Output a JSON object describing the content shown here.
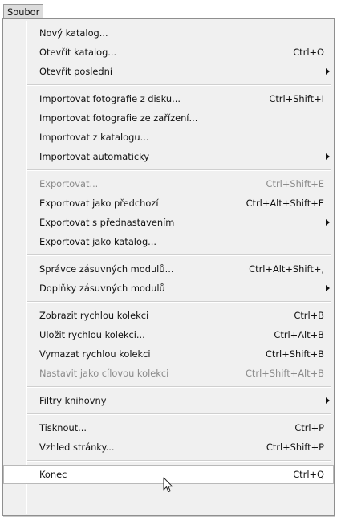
{
  "menu": {
    "title": "Soubor"
  },
  "groups": [
    [
      {
        "label": "Nový katalog...",
        "shortcut": "",
        "submenu": false,
        "disabled": false
      },
      {
        "label": "Otevřít katalog...",
        "shortcut": "Ctrl+O",
        "submenu": false,
        "disabled": false
      },
      {
        "label": "Otevřít poslední",
        "shortcut": "",
        "submenu": true,
        "disabled": false
      }
    ],
    [
      {
        "label": "Importovat fotografie z disku...",
        "shortcut": "Ctrl+Shift+I",
        "submenu": false,
        "disabled": false
      },
      {
        "label": "Importovat fotografie ze zařízení...",
        "shortcut": "",
        "submenu": false,
        "disabled": false
      },
      {
        "label": "Importovat z katalogu...",
        "shortcut": "",
        "submenu": false,
        "disabled": false
      },
      {
        "label": "Importovat automaticky",
        "shortcut": "",
        "submenu": true,
        "disabled": false
      }
    ],
    [
      {
        "label": "Exportovat...",
        "shortcut": "Ctrl+Shift+E",
        "submenu": false,
        "disabled": true
      },
      {
        "label": "Exportovat jako předchozí",
        "shortcut": "Ctrl+Alt+Shift+E",
        "submenu": false,
        "disabled": false
      },
      {
        "label": "Exportovat s přednastavením",
        "shortcut": "",
        "submenu": true,
        "disabled": false
      },
      {
        "label": "Exportovat jako katalog...",
        "shortcut": "",
        "submenu": false,
        "disabled": false
      }
    ],
    [
      {
        "label": "Správce zásuvných modulů...",
        "shortcut": "Ctrl+Alt+Shift+,",
        "submenu": false,
        "disabled": false
      },
      {
        "label": "Doplňky zásuvných modulů",
        "shortcut": "",
        "submenu": true,
        "disabled": false
      }
    ],
    [
      {
        "label": "Zobrazit rychlou kolekci",
        "shortcut": "Ctrl+B",
        "submenu": false,
        "disabled": false
      },
      {
        "label": "Uložit rychlou kolekci...",
        "shortcut": "Ctrl+Alt+B",
        "submenu": false,
        "disabled": false
      },
      {
        "label": "Vymazat rychlou kolekci",
        "shortcut": "Ctrl+Shift+B",
        "submenu": false,
        "disabled": false
      },
      {
        "label": "Nastavit jako cílovou kolekci",
        "shortcut": "Ctrl+Shift+Alt+B",
        "submenu": false,
        "disabled": true
      }
    ],
    [
      {
        "label": "Filtry knihovny",
        "shortcut": "",
        "submenu": true,
        "disabled": false
      }
    ],
    [
      {
        "label": "Tisknout...",
        "shortcut": "Ctrl+P",
        "submenu": false,
        "disabled": false
      },
      {
        "label": "Vzhled stránky...",
        "shortcut": "Ctrl+Shift+P",
        "submenu": false,
        "disabled": false
      }
    ],
    [
      {
        "label": "Konec",
        "shortcut": "Ctrl+Q",
        "submenu": false,
        "disabled": false,
        "highlighted": true
      }
    ]
  ],
  "icons": {
    "submenu": "triangle-right-icon",
    "cursor": "mouse-pointer-icon"
  }
}
